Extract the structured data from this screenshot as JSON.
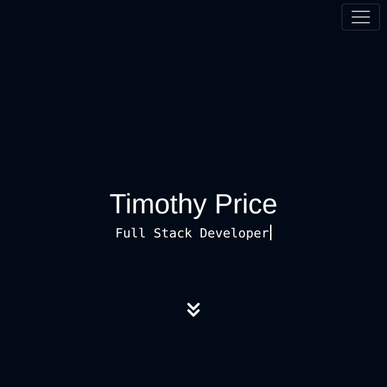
{
  "nav": {
    "toggle_icon": "hamburger-menu-icon"
  },
  "hero": {
    "name": "Timothy Price",
    "role": "Full Stack Developer",
    "cursor_char": "|"
  },
  "scroll_down": {
    "icon": "double-chevron-down-icon"
  },
  "colors": {
    "background": "#020a17",
    "text": "#ffffff",
    "toggle_border": "#2b3340",
    "toggle_bars": "#aeb3ba"
  }
}
